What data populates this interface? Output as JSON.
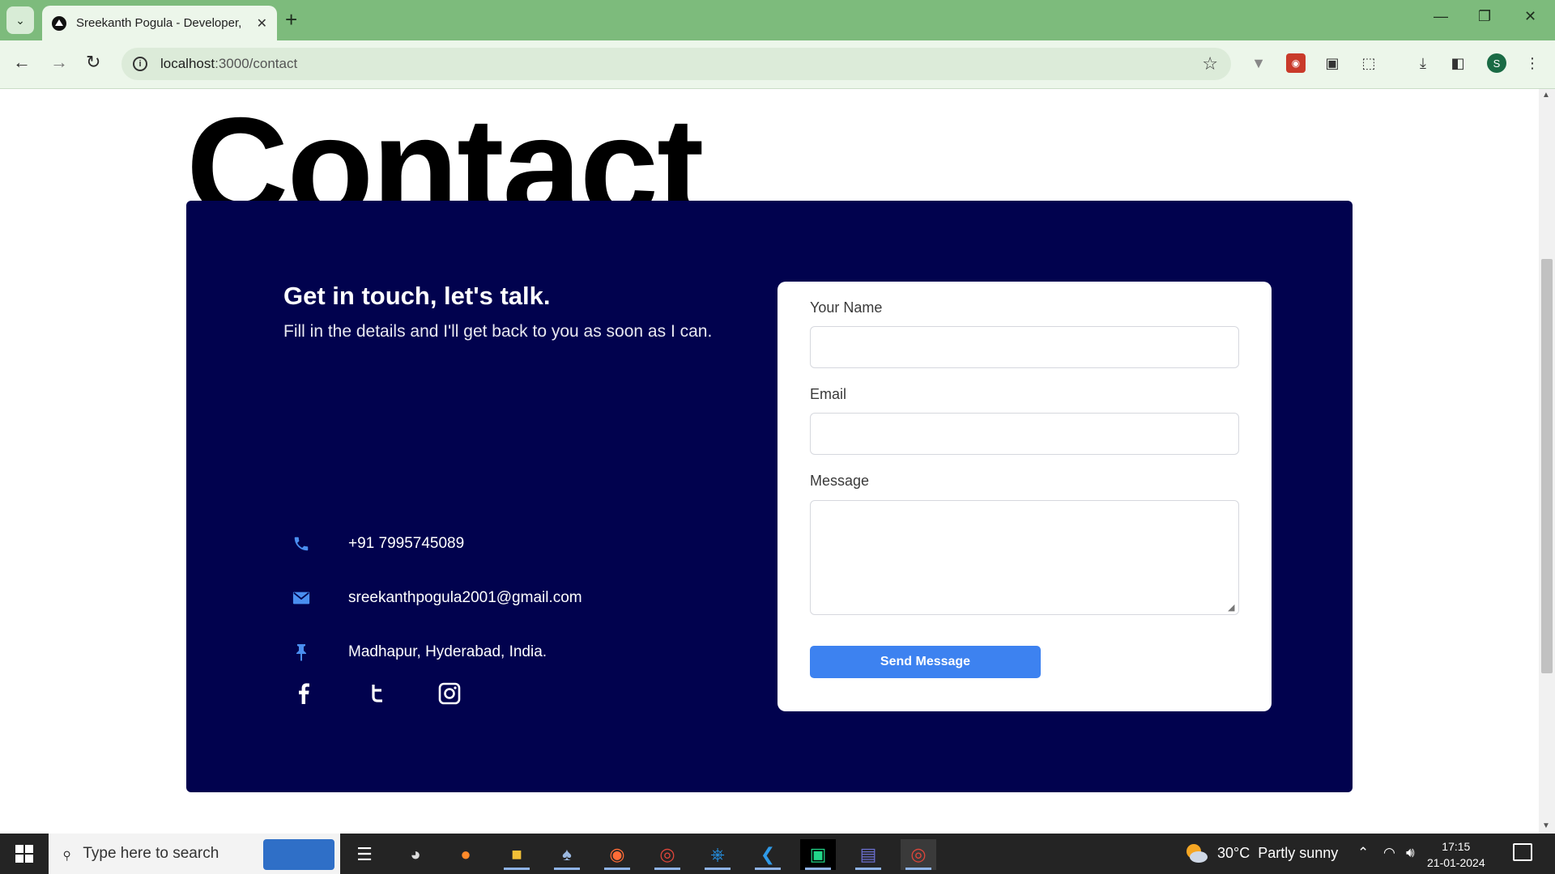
{
  "browser": {
    "tab_title": "Sreekanth Pogula - Developer, \\",
    "tab_list_icon": "chevron-down-icon",
    "new_tab_label": "+",
    "url_host": "localhost",
    "url_path": ":3000/contact",
    "profile_initial": "S",
    "extensions": [
      "vue-devtools-icon",
      "colorpick-icon",
      "save-icon",
      "extensions-puzzle-icon"
    ]
  },
  "page": {
    "title": "Contact",
    "heading": "Get in touch, let's talk.",
    "subheading": "Fill in the details and I'll get back to you as soon as I can.",
    "contact_info": [
      {
        "icon": "phone-icon",
        "text": "+91 7995745089"
      },
      {
        "icon": "mail-icon",
        "text": "sreekanthpogula2001@gmail.com"
      },
      {
        "icon": "pin-icon",
        "text": "Madhapur, Hyderabad, India."
      }
    ],
    "socials": [
      "facebook-icon",
      "twitter-icon",
      "instagram-icon"
    ],
    "form": {
      "name_label": "Your Name",
      "name_value": "",
      "email_label": "Email",
      "email_value": "",
      "message_label": "Message",
      "message_value": "",
      "submit_label": "Send Message"
    },
    "colors": {
      "card_bg": "#01024e",
      "accent": "#3d82f0",
      "icon_blue": "#4a8ef0"
    }
  },
  "taskbar": {
    "search_placeholder": "Type here to search",
    "weather_temp": "30°C",
    "weather_desc": "Partly sunny",
    "time": "17:15",
    "date": "21-01-2024",
    "apps": [
      "task-view-icon",
      "media-icon",
      "firefox-icon",
      "file-explorer-icon",
      "postgres-icon",
      "postman-icon",
      "chrome-icon",
      "docker-icon",
      "vscode-icon",
      "pycharm-icon",
      "teams-icon",
      "chrome-profile-icon"
    ]
  }
}
